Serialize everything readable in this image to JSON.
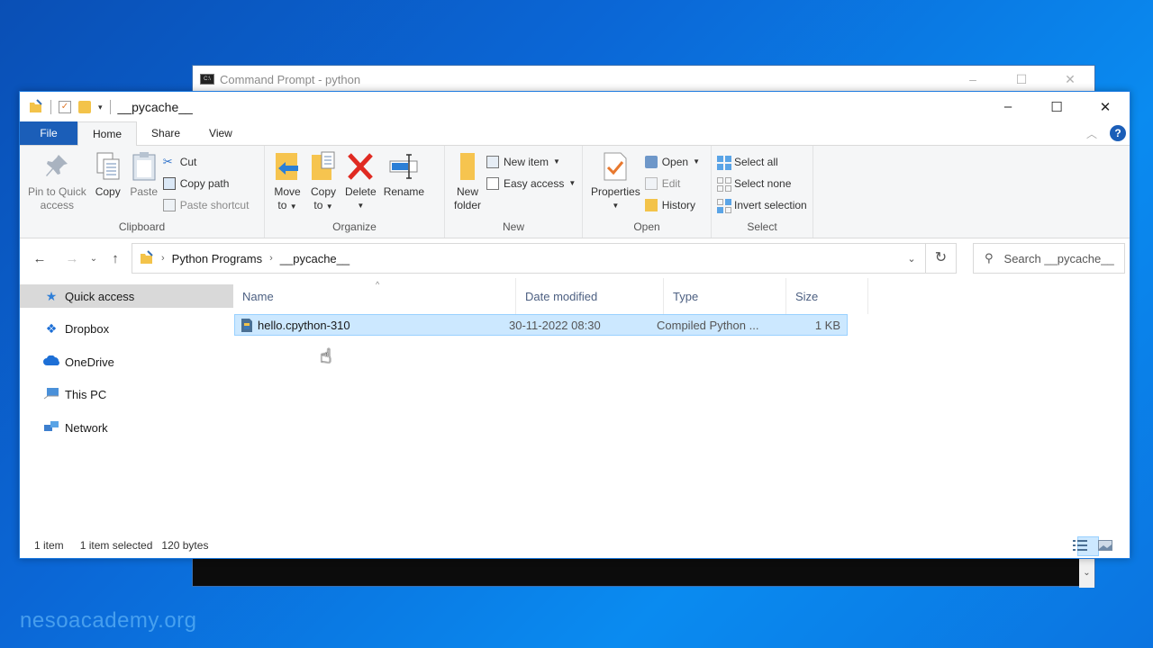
{
  "watermark": "nesoacademy.org",
  "cmd_window": {
    "title": "Command Prompt - python",
    "controls": {
      "minimize": "–",
      "maximize": "☐",
      "close": "✕"
    }
  },
  "explorer": {
    "title": "__pycache__",
    "controls": {
      "minimize": "–",
      "maximize": "☐",
      "close": "✕"
    },
    "tabs": [
      {
        "label": "File"
      },
      {
        "label": "Home"
      },
      {
        "label": "Share"
      },
      {
        "label": "View"
      }
    ],
    "ribbon": {
      "clipboard": {
        "label": "Clipboard",
        "pin": "Pin to Quick access",
        "pin_line1": "Pin to Quick",
        "pin_line2": "access",
        "copy": "Copy",
        "paste": "Paste",
        "cut": "Cut",
        "copy_path": "Copy path",
        "paste_shortcut": "Paste shortcut"
      },
      "organize": {
        "label": "Organize",
        "move_to_1": "Move",
        "move_to_2": "to",
        "copy_to_1": "Copy",
        "copy_to_2": "to",
        "delete": "Delete",
        "rename": "Rename"
      },
      "new": {
        "label": "New",
        "new_folder_1": "New",
        "new_folder_2": "folder",
        "new_item": "New item",
        "easy_access": "Easy access"
      },
      "open": {
        "label": "Open",
        "properties": "Properties",
        "open": "Open",
        "edit": "Edit",
        "history": "History"
      },
      "select": {
        "label": "Select",
        "select_all": "Select all",
        "select_none": "Select none",
        "invert_selection": "Invert selection"
      }
    },
    "address": {
      "path": [
        "Python Programs",
        "__pycache__"
      ]
    },
    "search": {
      "placeholder": "Search __pycache__"
    },
    "nav_pane": [
      {
        "label": "Quick access",
        "icon": "star-icon",
        "selected": true
      },
      {
        "label": "Dropbox",
        "icon": "dropbox-icon"
      },
      {
        "label": "OneDrive",
        "icon": "onedrive-icon"
      },
      {
        "label": "This PC",
        "icon": "computer-icon"
      },
      {
        "label": "Network",
        "icon": "network-icon"
      }
    ],
    "columns": [
      "Name",
      "Date modified",
      "Type",
      "Size"
    ],
    "files": [
      {
        "name": "hello.cpython-310",
        "date": "30-11-2022 08:30",
        "type": "Compiled Python ...",
        "size": "1 KB",
        "selected": true
      }
    ],
    "status": {
      "count": "1 item",
      "selected": "1 item selected",
      "size": "120 bytes"
    }
  }
}
